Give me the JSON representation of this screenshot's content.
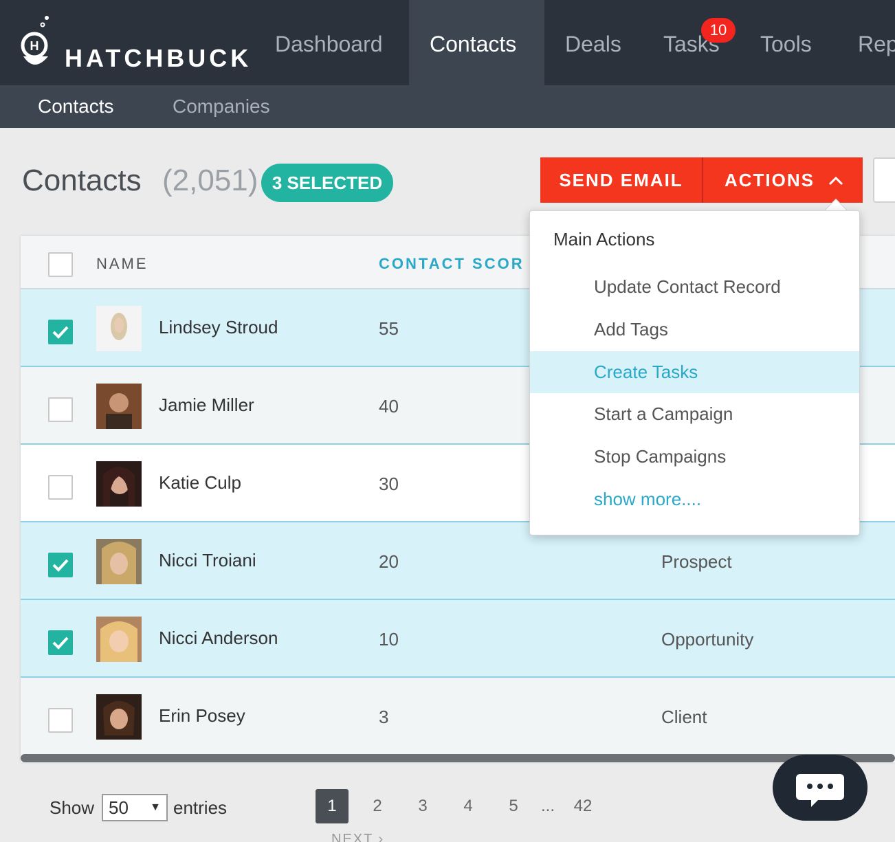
{
  "brand": {
    "name": "HATCHBUCK"
  },
  "nav": {
    "tabs": [
      {
        "label": "Dashboard"
      },
      {
        "label": "Contacts"
      },
      {
        "label": "Deals"
      },
      {
        "label": "Tasks"
      },
      {
        "label": "Tools"
      },
      {
        "label": "Rep"
      }
    ],
    "active_tab": "Contacts",
    "tasks_badge": "10"
  },
  "subnav": {
    "items": [
      {
        "label": "Contacts"
      },
      {
        "label": "Companies"
      }
    ],
    "active_item": "Contacts"
  },
  "header": {
    "title": "Contacts",
    "count": "(2,051)",
    "selected": "3 SELECTED",
    "send_email": "SEND EMAIL",
    "actions": "ACTIONS"
  },
  "table": {
    "columns": {
      "name": "NAME",
      "score": "CONTACT SCOR"
    },
    "rows": [
      {
        "name": "Lindsey Stroud",
        "score": "55",
        "status": "",
        "checked": true
      },
      {
        "name": "Jamie Miller",
        "score": "40",
        "status": "",
        "checked": false
      },
      {
        "name": "Katie Culp",
        "score": "30",
        "status": "",
        "checked": false
      },
      {
        "name": "Nicci Troiani",
        "score": "20",
        "status": "Prospect",
        "checked": true
      },
      {
        "name": "Nicci Anderson",
        "score": "10",
        "status": "Opportunity",
        "checked": true
      },
      {
        "name": "Erin Posey",
        "score": "3",
        "status": "Client",
        "checked": false
      }
    ]
  },
  "dropdown": {
    "heading": "Main Actions",
    "items": [
      {
        "label": "Update Contact Record"
      },
      {
        "label": "Add Tags"
      },
      {
        "label": "Create Tasks"
      },
      {
        "label": "Start a Campaign"
      },
      {
        "label": "Stop Campaigns"
      },
      {
        "label": "show more...."
      }
    ],
    "highlighted": "Create Tasks"
  },
  "footer": {
    "show": "Show",
    "page_size": "50",
    "entries": "entries",
    "pages": [
      "1",
      "2",
      "3",
      "4",
      "5",
      "...",
      "42"
    ],
    "current_page": "1",
    "next": "NEXT ›"
  },
  "colors": {
    "accent": "#22b3a1",
    "primary_button": "#f4361f",
    "nav_bg": "#2b323b",
    "link": "#2aa8c8"
  }
}
